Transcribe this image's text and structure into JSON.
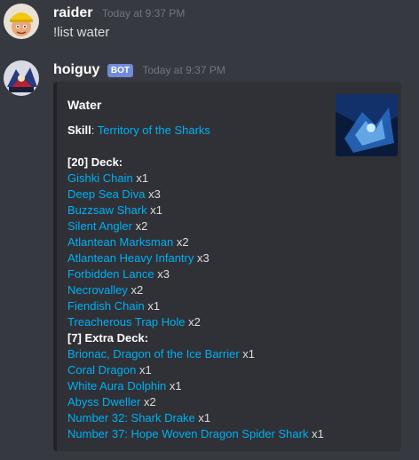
{
  "messages": [
    {
      "username": "raider",
      "timestamp": "Today at 9:37 PM",
      "text": "!list water"
    },
    {
      "username": "hoiguy",
      "bot_tag": "BOT",
      "timestamp": "Today at 9:37 PM",
      "embed": {
        "title": "Water",
        "skill_label": "Skill",
        "skill_value": "Territory of the Sharks",
        "deck_header": "[20] Deck:",
        "deck": [
          {
            "name": "Gishki Chain",
            "count": "x1"
          },
          {
            "name": "Deep Sea Diva",
            "count": "x3"
          },
          {
            "name": "Buzzsaw Shark",
            "count": "x1"
          },
          {
            "name": "Silent Angler",
            "count": "x2"
          },
          {
            "name": "Atlantean Marksman",
            "count": "x2"
          },
          {
            "name": "Atlantean Heavy Infantry",
            "count": "x3"
          },
          {
            "name": "Forbidden Lance",
            "count": "x3"
          },
          {
            "name": "Necrovalley",
            "count": "x2"
          },
          {
            "name": "Fiendish Chain",
            "count": "x1"
          },
          {
            "name": "Treacherous Trap Hole",
            "count": "x2"
          }
        ],
        "extra_header": "[7] Extra Deck:",
        "extra": [
          {
            "name": "Brionac, Dragon of the Ice Barrier",
            "count": "x1"
          },
          {
            "name": "Coral Dragon",
            "count": "x1"
          },
          {
            "name": "White Aura Dolphin",
            "count": "x1"
          },
          {
            "name": "Abyss Dweller",
            "count": "x2"
          },
          {
            "name": "Number 32: Shark Drake",
            "count": "x1"
          },
          {
            "name": "Number 37: Hope Woven Dragon Spider Shark",
            "count": "x1"
          }
        ]
      }
    }
  ],
  "colors": {
    "background": "#36393f",
    "embed_bg": "#2f3136",
    "link": "#00b0f4",
    "bot_tag": "#7289da",
    "timestamp": "#72767d"
  }
}
